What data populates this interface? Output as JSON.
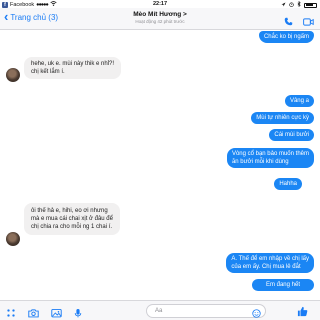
{
  "status_bar": {
    "carrier": "Facebook",
    "signal": "●●●●●",
    "network": "",
    "time": "22:17"
  },
  "header": {
    "back_label": "Trang chủ (3)",
    "contact_name": "Mèo Mít Hương >",
    "contact_status": "Hoạt động 42 phút trước"
  },
  "messages": [
    {
      "id": "m1",
      "side": "out",
      "text": "Chắc ko bị ngấm"
    },
    {
      "id": "m2",
      "side": "in",
      "lines": [
        "hehe, uk e. mùi này thik e nhỉ?!",
        "chị kết lắm í."
      ]
    },
    {
      "id": "m3",
      "side": "out",
      "text": "Vâng a"
    },
    {
      "id": "m4",
      "side": "out",
      "text": "Mùi tự nhiên cực kỳ"
    },
    {
      "id": "m5",
      "side": "out",
      "text": "Cái mùi bưởi"
    },
    {
      "id": "m6",
      "side": "out",
      "lines": [
        "Vòng cổ bạn bảo muốn thêm",
        "ăn bưởi mỗi khi dùng"
      ]
    },
    {
      "id": "m7",
      "side": "out",
      "text": "Hahha"
    },
    {
      "id": "m8",
      "side": "in",
      "lines": [
        "ôi thế hả e, hihi, eo ơi nhưng",
        "mà e mua cái chai xịt ở đâu để",
        "chị chia ra cho mỗi ng 1 chai í."
      ]
    },
    {
      "id": "m9",
      "side": "out",
      "lines": [
        "A. Thế để em nhập về chị lấy",
        "của em ấy. Chị mua lẻ đắt"
      ]
    },
    {
      "id": "m10",
      "side": "out",
      "text": "Em đang hết"
    }
  ],
  "composer": {
    "placeholder": "Aa"
  },
  "colors": {
    "accent": "#1a7cf5",
    "outgoing_bubble": "#1b86f4",
    "incoming_bubble": "#f1f0f0"
  },
  "icons": [
    "chevron-left-icon",
    "phone-icon",
    "video-camera-icon",
    "apps-icon",
    "camera-icon",
    "photo-icon",
    "microphone-icon",
    "emoji-icon",
    "like-icon"
  ]
}
